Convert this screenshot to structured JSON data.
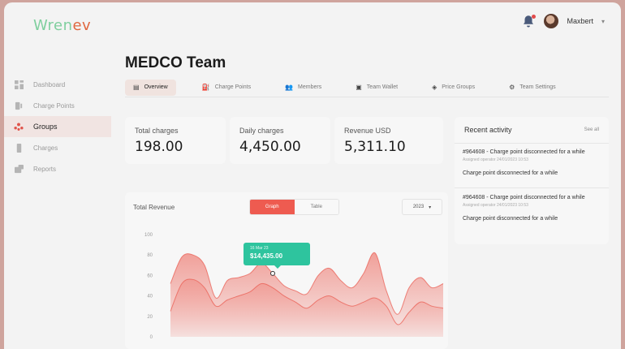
{
  "app": {
    "logo_part1": "Wren",
    "logo_part2": "ev"
  },
  "user": {
    "name": "Maxbert"
  },
  "sidebar": {
    "items": [
      {
        "label": "Dashboard",
        "icon": "dashboard-icon"
      },
      {
        "label": "Charge Points",
        "icon": "charge-point-icon"
      },
      {
        "label": "Groups",
        "icon": "groups-icon"
      },
      {
        "label": "Charges",
        "icon": "charges-icon"
      },
      {
        "label": "Reports",
        "icon": "reports-icon"
      }
    ]
  },
  "page": {
    "title": "MEDCO Team"
  },
  "tabs": [
    {
      "label": "Overview"
    },
    {
      "label": "Charge Points"
    },
    {
      "label": "Members"
    },
    {
      "label": "Team Wallet"
    },
    {
      "label": "Price Groups"
    },
    {
      "label": "Team Settings"
    }
  ],
  "stats": [
    {
      "label": "Total charges",
      "value": "198.00"
    },
    {
      "label": "Daily charges",
      "value": "4,450.00"
    },
    {
      "label": "Revenue USD",
      "value": "5,311.10"
    }
  ],
  "activity": {
    "title": "Recent activity",
    "see_all": "See all",
    "items": [
      {
        "head": "#964608 - Charge point disconnected for a while",
        "sub": "Assigned operator 24/01/2023 10:53",
        "text": "Charge point disconnected for a while"
      },
      {
        "head": "#964608 - Charge point disconnected for a while",
        "sub": "Assigned operator 24/01/2023 10:53",
        "text": "Charge point disconnected for a while"
      }
    ]
  },
  "revenue": {
    "title": "Total Revenue",
    "toggle": {
      "graph": "Graph",
      "table": "Table"
    },
    "year": "2023",
    "tooltip": {
      "date": "16 Mar 23",
      "value": "$14,435.00"
    }
  },
  "chart_data": {
    "type": "area",
    "ylim": [
      0,
      100
    ],
    "yticks": [
      0,
      20,
      40,
      60,
      80,
      100
    ],
    "series": [
      {
        "values": [
          52,
          78,
          80,
          70,
          38,
          55,
          58,
          62,
          72,
          62,
          50,
          45,
          42,
          60,
          67,
          55,
          48,
          62,
          82,
          45,
          22,
          48,
          58,
          48,
          52
        ]
      },
      {
        "values": [
          25,
          52,
          56,
          48,
          30,
          36,
          40,
          44,
          52,
          48,
          40,
          34,
          28,
          36,
          40,
          34,
          30,
          34,
          38,
          30,
          12,
          24,
          34,
          30,
          28
        ]
      }
    ],
    "colors": {
      "area": "#ef8a82",
      "line": "#e9574c"
    }
  }
}
